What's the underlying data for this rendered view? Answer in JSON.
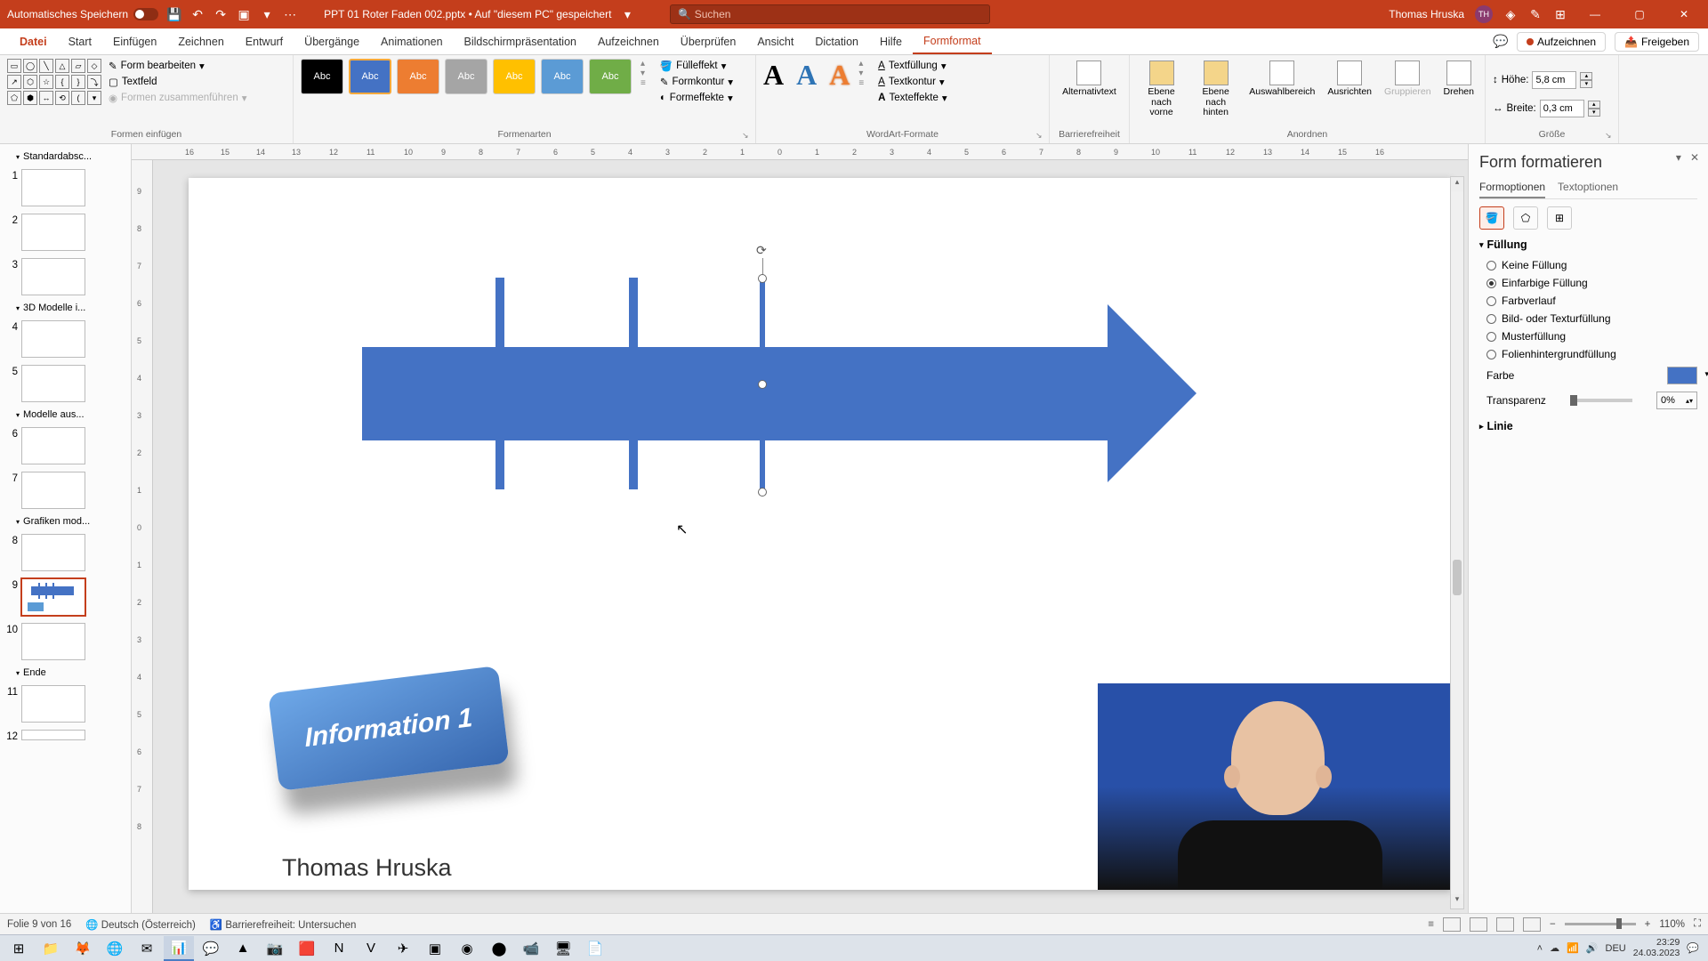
{
  "titlebar": {
    "autosave": "Automatisches Speichern",
    "filename": "PPT 01 Roter Faden 002.pptx • Auf \"diesem PC\" gespeichert",
    "search_placeholder": "Suchen",
    "user": "Thomas Hruska",
    "initials": "TH"
  },
  "tabs": {
    "file": "Datei",
    "start": "Start",
    "insert": "Einfügen",
    "draw": "Zeichnen",
    "design": "Entwurf",
    "transitions": "Übergänge",
    "animations": "Animationen",
    "slideshow": "Bildschirmpräsentation",
    "record_tab": "Aufzeichnen",
    "review": "Überprüfen",
    "view": "Ansicht",
    "dictation": "Dictation",
    "help": "Hilfe",
    "shapeformat": "Formformat",
    "record_btn": "Aufzeichnen",
    "share": "Freigeben"
  },
  "ribbon": {
    "insert_group": "Formen einfügen",
    "edit_shape": "Form bearbeiten",
    "textbox": "Textfeld",
    "merge": "Formen zusammenführen",
    "styles_group": "Formenarten",
    "style_label": "Abc",
    "fill_effect": "Fülleffekt",
    "shape_contour": "Formkontur",
    "shape_effects": "Formeffekte",
    "wordart_group": "WordArt-Formate",
    "text_fill": "Textfüllung",
    "text_contour": "Textkontur",
    "text_effects": "Texteffekte",
    "acc_group": "Barrierefreiheit",
    "alt_text": "Alternativtext",
    "arrange_group": "Anordnen",
    "bring_front": "Ebene nach\nvorne",
    "send_back": "Ebene nach\nhinten",
    "selection": "Auswahlbereich",
    "align": "Ausrichten",
    "group": "Gruppieren",
    "rotate": "Drehen",
    "size_group": "Größe",
    "height_lbl": "Höhe:",
    "height_val": "5,8 cm",
    "width_lbl": "Breite:",
    "width_val": "0,3 cm"
  },
  "thumbs": {
    "sec1": "Standardabsc...",
    "sec2": "3D Modelle i...",
    "sec3": "Modelle aus...",
    "sec4": "Grafiken mod...",
    "sec5": "Ende"
  },
  "slide": {
    "info_text": "Information 1",
    "author": "Thomas Hruska"
  },
  "pane": {
    "title": "Form formatieren",
    "tab_shape": "Formoptionen",
    "tab_text": "Textoptionen",
    "fill": "Füllung",
    "no_fill": "Keine Füllung",
    "solid": "Einfarbige Füllung",
    "gradient": "Farbverlauf",
    "picture": "Bild- oder Texturfüllung",
    "pattern": "Musterfüllung",
    "slide_bg": "Folienhintergrundfüllung",
    "color": "Farbe",
    "transparency": "Transparenz",
    "transparency_val": "0%",
    "line": "Linie"
  },
  "status": {
    "slide": "Folie 9 von 16",
    "lang": "Deutsch (Österreich)",
    "acc": "Barrierefreiheit: Untersuchen",
    "zoom": "110%"
  },
  "tray": {
    "kb": "DEU",
    "time": "23:29",
    "date": "24.03.2023"
  }
}
